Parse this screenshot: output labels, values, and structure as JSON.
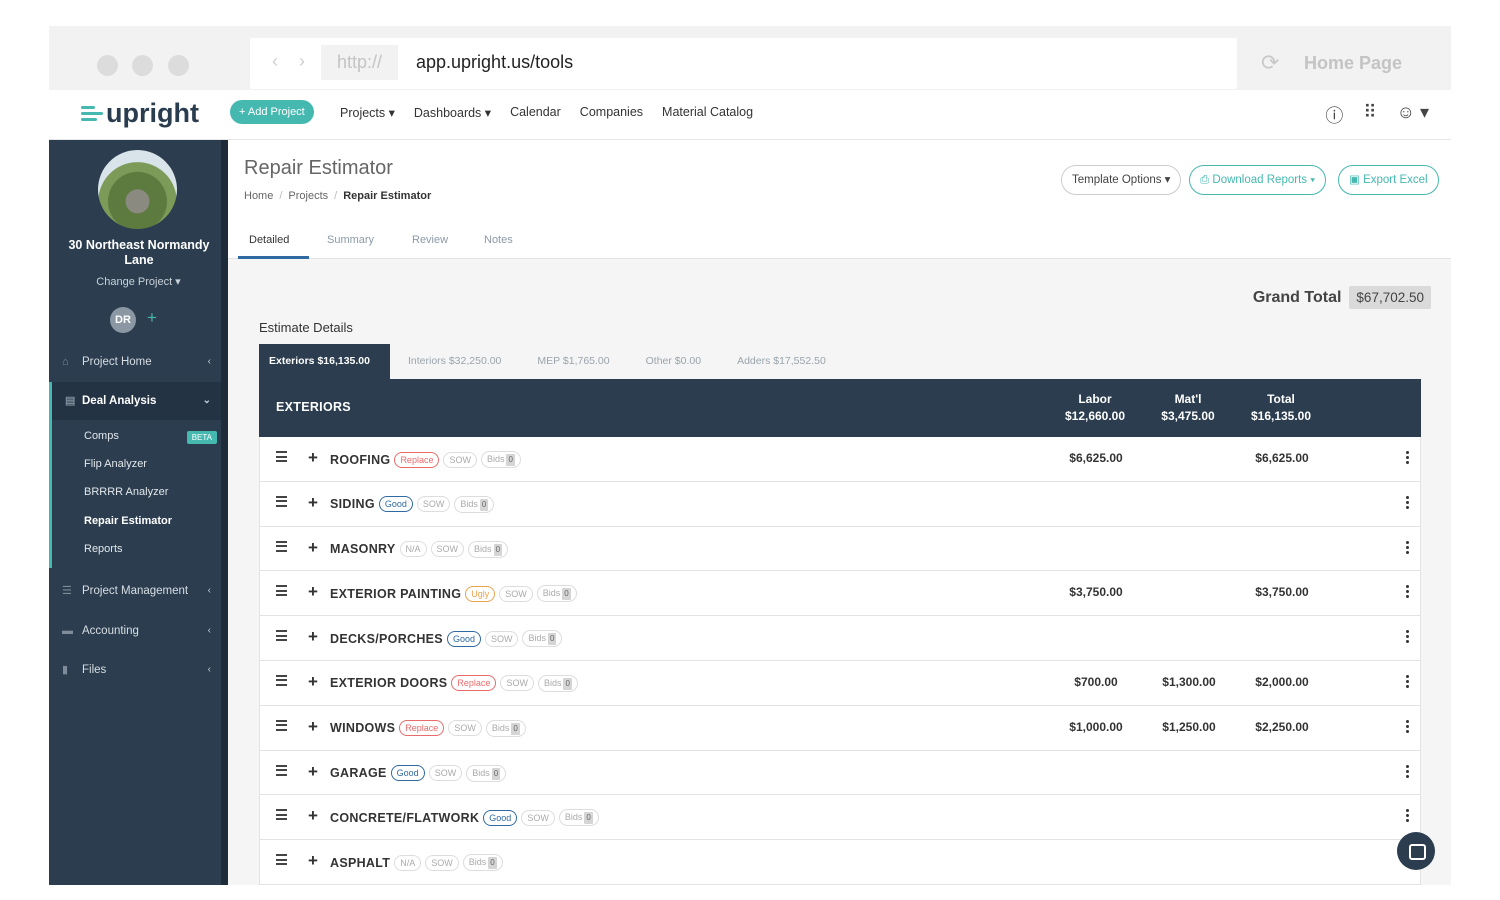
{
  "browser": {
    "http_label": "http://",
    "url": "app.upright.us/tools",
    "home_label": "Home Page"
  },
  "topnav": {
    "logo": "upright",
    "add_project": "+ Add Project",
    "items": [
      "Projects ▾",
      "Dashboards ▾",
      "Calendar",
      "Companies",
      "Material Catalog"
    ]
  },
  "sidebar": {
    "address": "30 Northeast Normandy Lane",
    "change_project": "Change Project ▾",
    "initials": "DR",
    "items": [
      {
        "label": "Project Home"
      },
      {
        "label": "Deal Analysis"
      },
      {
        "label": "Project Management"
      },
      {
        "label": "Accounting"
      },
      {
        "label": "Files"
      }
    ],
    "sub_items": [
      {
        "label": "Comps",
        "badge": "BETA"
      },
      {
        "label": "Flip Analyzer"
      },
      {
        "label": "BRRRR Analyzer"
      },
      {
        "label": "Repair Estimator"
      },
      {
        "label": "Reports"
      }
    ]
  },
  "header": {
    "title": "Repair Estimator",
    "breadcrumb": [
      "Home",
      "Projects",
      "Repair Estimator"
    ],
    "buttons": {
      "template": "Template Options ▾",
      "download": "Download Reports ▾",
      "export": "Export Excel"
    }
  },
  "tabs": [
    "Detailed",
    "Summary",
    "Review",
    "Notes"
  ],
  "grand_total": {
    "label": "Grand Total",
    "value": "$67,702.50"
  },
  "estimate_label": "Estimate Details",
  "category_tabs": [
    "Exteriors $16,135.00",
    "Interiors $32,250.00",
    "MEP $1,765.00",
    "Other $0.00",
    "Adders $17,552.50"
  ],
  "table": {
    "title": "EXTERIORS",
    "columns": [
      {
        "label": "Labor",
        "total": "$12,660.00"
      },
      {
        "label": "Mat'l",
        "total": "$3,475.00"
      },
      {
        "label": "Total",
        "total": "$16,135.00"
      }
    ],
    "sow": "SOW",
    "bids": "Bids",
    "bids_count": "0",
    "rows": [
      {
        "name": "ROOFING",
        "cond": "Replace",
        "labor": "$6,625.00",
        "matl": "",
        "total": "$6,625.00"
      },
      {
        "name": "SIDING",
        "cond": "Good",
        "labor": "",
        "matl": "",
        "total": ""
      },
      {
        "name": "MASONRY",
        "cond": "N/A",
        "labor": "",
        "matl": "",
        "total": ""
      },
      {
        "name": "EXTERIOR PAINTING",
        "cond": "Ugly",
        "labor": "$3,750.00",
        "matl": "",
        "total": "$3,750.00"
      },
      {
        "name": "DECKS/PORCHES",
        "cond": "Good",
        "labor": "",
        "matl": "",
        "total": ""
      },
      {
        "name": "EXTERIOR DOORS",
        "cond": "Replace",
        "labor": "$700.00",
        "matl": "$1,300.00",
        "total": "$2,000.00"
      },
      {
        "name": "WINDOWS",
        "cond": "Replace",
        "labor": "$1,000.00",
        "matl": "$1,250.00",
        "total": "$2,250.00"
      },
      {
        "name": "GARAGE",
        "cond": "Good",
        "labor": "",
        "matl": "",
        "total": ""
      },
      {
        "name": "CONCRETE/FLATWORK",
        "cond": "Good",
        "labor": "",
        "matl": "",
        "total": ""
      },
      {
        "name": "ASPHALT",
        "cond": "N/A",
        "labor": "",
        "matl": "",
        "total": ""
      }
    ]
  },
  "colors": {
    "teal": "#45b8b0",
    "navy": "#2b3d4f",
    "blue": "#2f6aa3",
    "red": "#e96b6b",
    "orange": "#e9a24b"
  }
}
